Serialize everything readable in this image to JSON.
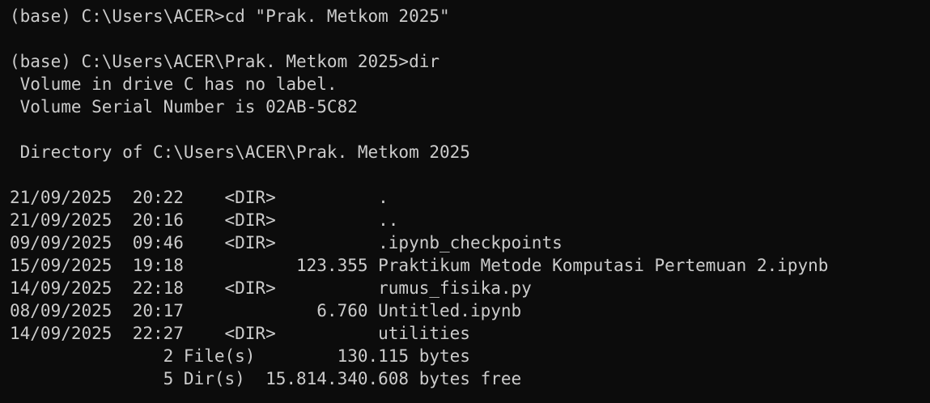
{
  "terminal": {
    "colors": {
      "background": "#0c0c0c",
      "foreground": "#cccccc"
    },
    "lines": [
      "(base) C:\\Users\\ACER>cd \"Prak. Metkom 2025\"",
      "",
      "(base) C:\\Users\\ACER\\Prak. Metkom 2025>dir",
      " Volume in drive C has no label.",
      " Volume Serial Number is 02AB-5C82",
      "",
      " Directory of C:\\Users\\ACER\\Prak. Metkom 2025",
      "",
      "21/09/2025  20:22    <DIR>          .",
      "21/09/2025  20:16    <DIR>          ..",
      "09/09/2025  09:46    <DIR>          .ipynb_checkpoints",
      "15/09/2025  19:18           123.355 Praktikum Metode Komputasi Pertemuan 2.ipynb",
      "14/09/2025  22:18    <DIR>          rumus_fisika.py",
      "08/09/2025  20:17             6.760 Untitled.ipynb",
      "14/09/2025  22:27    <DIR>          utilities",
      "               2 File(s)        130.115 bytes",
      "               5 Dir(s)  15.814.340.608 bytes free"
    ]
  }
}
